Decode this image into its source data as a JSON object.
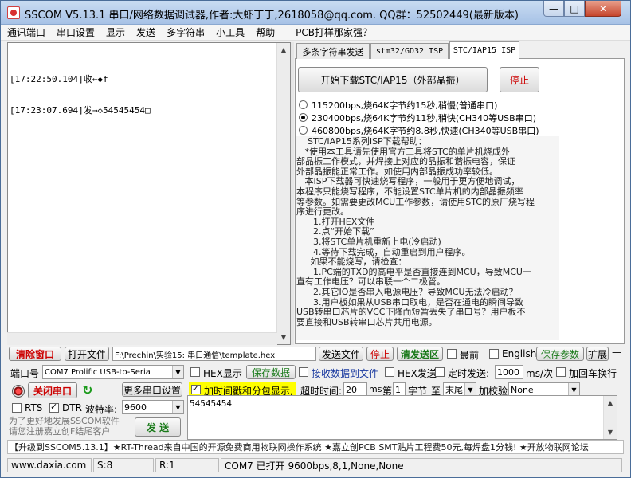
{
  "window": {
    "title": "SSCOM V5.13.1 串口/网络数据调试器,作者:大虾丁丁,2618058@qq.com. QQ群：52502449(最新版本)",
    "min": "—",
    "max": "□",
    "close": "✕"
  },
  "menu": [
    "通讯端口",
    "串口设置",
    "显示",
    "发送",
    "多字符串",
    "小工具",
    "帮助",
    "PCB打样那家强？"
  ],
  "receive": {
    "lines": [
      "[17:22:50.104]收←◆f",
      "[17:23:07.694]发→◇54545454□"
    ]
  },
  "tabs": [
    "多条字符串发送",
    "stm32/GD32 ISP",
    "STC/IAP15 ISP"
  ],
  "isp": {
    "start_btn": "开始下载STC/IAP15（外部晶振）",
    "stop_btn": "停止",
    "options": [
      {
        "label": "115200bps,烧64K字节约15秒,稍慢(普通串口)",
        "checked": false
      },
      {
        "label": "230400bps,烧64K字节约11秒,稍快(CH340等USB串口)",
        "checked": true
      },
      {
        "label": "460800bps,烧64K字节约8.8秒,快速(CH340等USB串口)",
        "checked": false
      }
    ],
    "help": [
      "    STC/IAP15系列ISP下载帮助：",
      "   *使用本工具请先使用官方工具将STC的单片机烧成外",
      "部晶振工作模式，并焊接上对应的晶振和谐振电容，保证",
      "外部晶振能正常工作。如使用内部晶振成功率较低。",
      "   本ISP下载器可快速烧写程序，一般用于更方便地调试，",
      "本程序只能烧写程序，不能设置STC单片机的内部晶振频率",
      "等参数。如需要更改MCU工作参数，请使用STC的原厂烧写程",
      "序进行更改。",
      "      1.打开HEX文件",
      "      2.点“开始下载”",
      "      3.将STC单片机重新上电(冷启动)",
      "      4.等待下载完成，自动重启到用户程序。",
      "     如果不能烧写，请检查：",
      "      1.PC端的TXD的高电平是否直接连到MCU，导致MCU一",
      "直有工作电压？可以串联一个二极管。",
      "      2.其它IO是否串入电源电压？导致MCU无法冷启动？",
      "      3.用户板如果从USB串口取电，是否在通电的瞬间导致",
      "USB转串口芯片的VCC下降而短暂丢失了串口号？用户板不",
      "要直接和USB转串口芯片共用电源。"
    ]
  },
  "toolbar1": {
    "clear": "清除窗口",
    "open_file": "打开文件",
    "file_path": "F:\\Prechin\\实验15: 串口通信\\template.hex",
    "send_file": "发送文件",
    "stop": "停止",
    "clear_send": "清发送区",
    "topmost": "最前",
    "english": "English",
    "save_params": "保存参数",
    "expand": "扩展",
    "collapse": "—"
  },
  "port": {
    "port_label": "端口号",
    "port_value": "COM7 Prolific USB-to-Seria",
    "hex_display": "HEX显示",
    "save_data": "保存数据",
    "recv_to_file": "接收数据到文件",
    "hex_send": "HEX发送",
    "timed_send": "定时发送:",
    "interval": "1000",
    "unit": "ms/次",
    "add_newline": "加回车换行"
  },
  "port2": {
    "close_port": "关闭串口",
    "more_settings": "更多串口设置",
    "timestamp": "加时间戳和分包显示,",
    "timeout_label": "超时时间:",
    "timeout": "20",
    "ms": "ms",
    "nth": "第",
    "byte_no": "1",
    "byte_label": "字节",
    "to": "至",
    "end": "末尾",
    "checksum_label": "加校验",
    "checksum": "None"
  },
  "port3": {
    "rts": "RTS",
    "dtr": "DTR",
    "baud_label": "波特率:",
    "baud": "9600",
    "send_text": "54545454",
    "send_btn": "发 送",
    "promo_left": "为了更好地发展SSCOM软件\n请您注册嘉立创F结尾客户"
  },
  "promo": "【升级到SSCOM5.13.1】★RT-Thread来自中国的开源免费商用物联网操作系统 ★嘉立创PCB SMT贴片工程费50元,每焊盘1分钱! ★开放物联网论坛",
  "status": {
    "site": "www.daxia.com",
    "sent": "S:8",
    "recv": "R:1",
    "info": "COM7 已打开  9600bps,8,1,None,None"
  },
  "colors": {
    "accent_red": "#c00000",
    "accent_green": "#1a7a1a",
    "timestamp_bg": "#ffff00"
  }
}
